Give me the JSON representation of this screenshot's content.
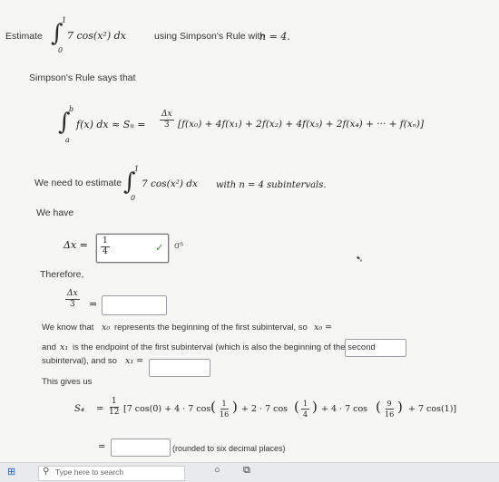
{
  "question": {
    "prefix": "Estimate",
    "integrand": "7 cos(x²) dx",
    "suffix": "using Simpson's Rule with",
    "n_text": "n = 4."
  },
  "rule": {
    "says": "Simpson's Rule says that",
    "lhs": "f(x) dx ≈ Sₙ =",
    "dx_num": "Δx",
    "dx_den": "3",
    "rhs": "[f(x₀) + 4f(x₁) + 2f(x₂) + 4f(x₃) + 2f(x₄) + ··· + f(xₙ)]"
  },
  "need": {
    "prefix": "We need to estimate",
    "integrand": "7 cos(x²) dx",
    "with_text": "with n = 4 subintervals."
  },
  "limits": {
    "upper": "b",
    "lower": "a",
    "upper_num": "1",
    "lower_num": "0"
  },
  "have": {
    "label": "We have",
    "dx_lhs": "Δx =",
    "dx_value_num": "1",
    "dx_value_den": "4",
    "check": "✓",
    "sigma": "σ⁶"
  },
  "therefore": {
    "label": "Therefore,",
    "frac_num": "Δx",
    "frac_den": "3",
    "eq": "="
  },
  "know": {
    "line1a": "We know that",
    "x0": "x₀",
    "line1b": "represents the beginning of the first subinterval, so",
    "x0_eq": "x₀ =",
    "line2a": "and",
    "x1": "x₁",
    "line2b": "is the endpoint of the first subinterval (which is also the beginning of the second",
    "line3": "subinterval), and so",
    "x1_eq": "x₁ ="
  },
  "gives": {
    "label": "This gives us",
    "s4": "S₄",
    "eq": "=",
    "coef_num": "1",
    "coef_den": "12",
    "t1": "[7 cos(0) + 4 · 7 cos",
    "a_num": "1",
    "a_den": "16",
    "t2": "+ 2 · 7 cos",
    "b_num": "1",
    "b_den": "4",
    "t3": "+ 4 · 7 cos",
    "c_num": "9",
    "c_den": "16",
    "t4": "+ 7 cos(1)]",
    "approx_eq": "=",
    "rounded": "(rounded to six decimal places)"
  },
  "taskbar": {
    "search_placeholder": "Type here to search"
  }
}
